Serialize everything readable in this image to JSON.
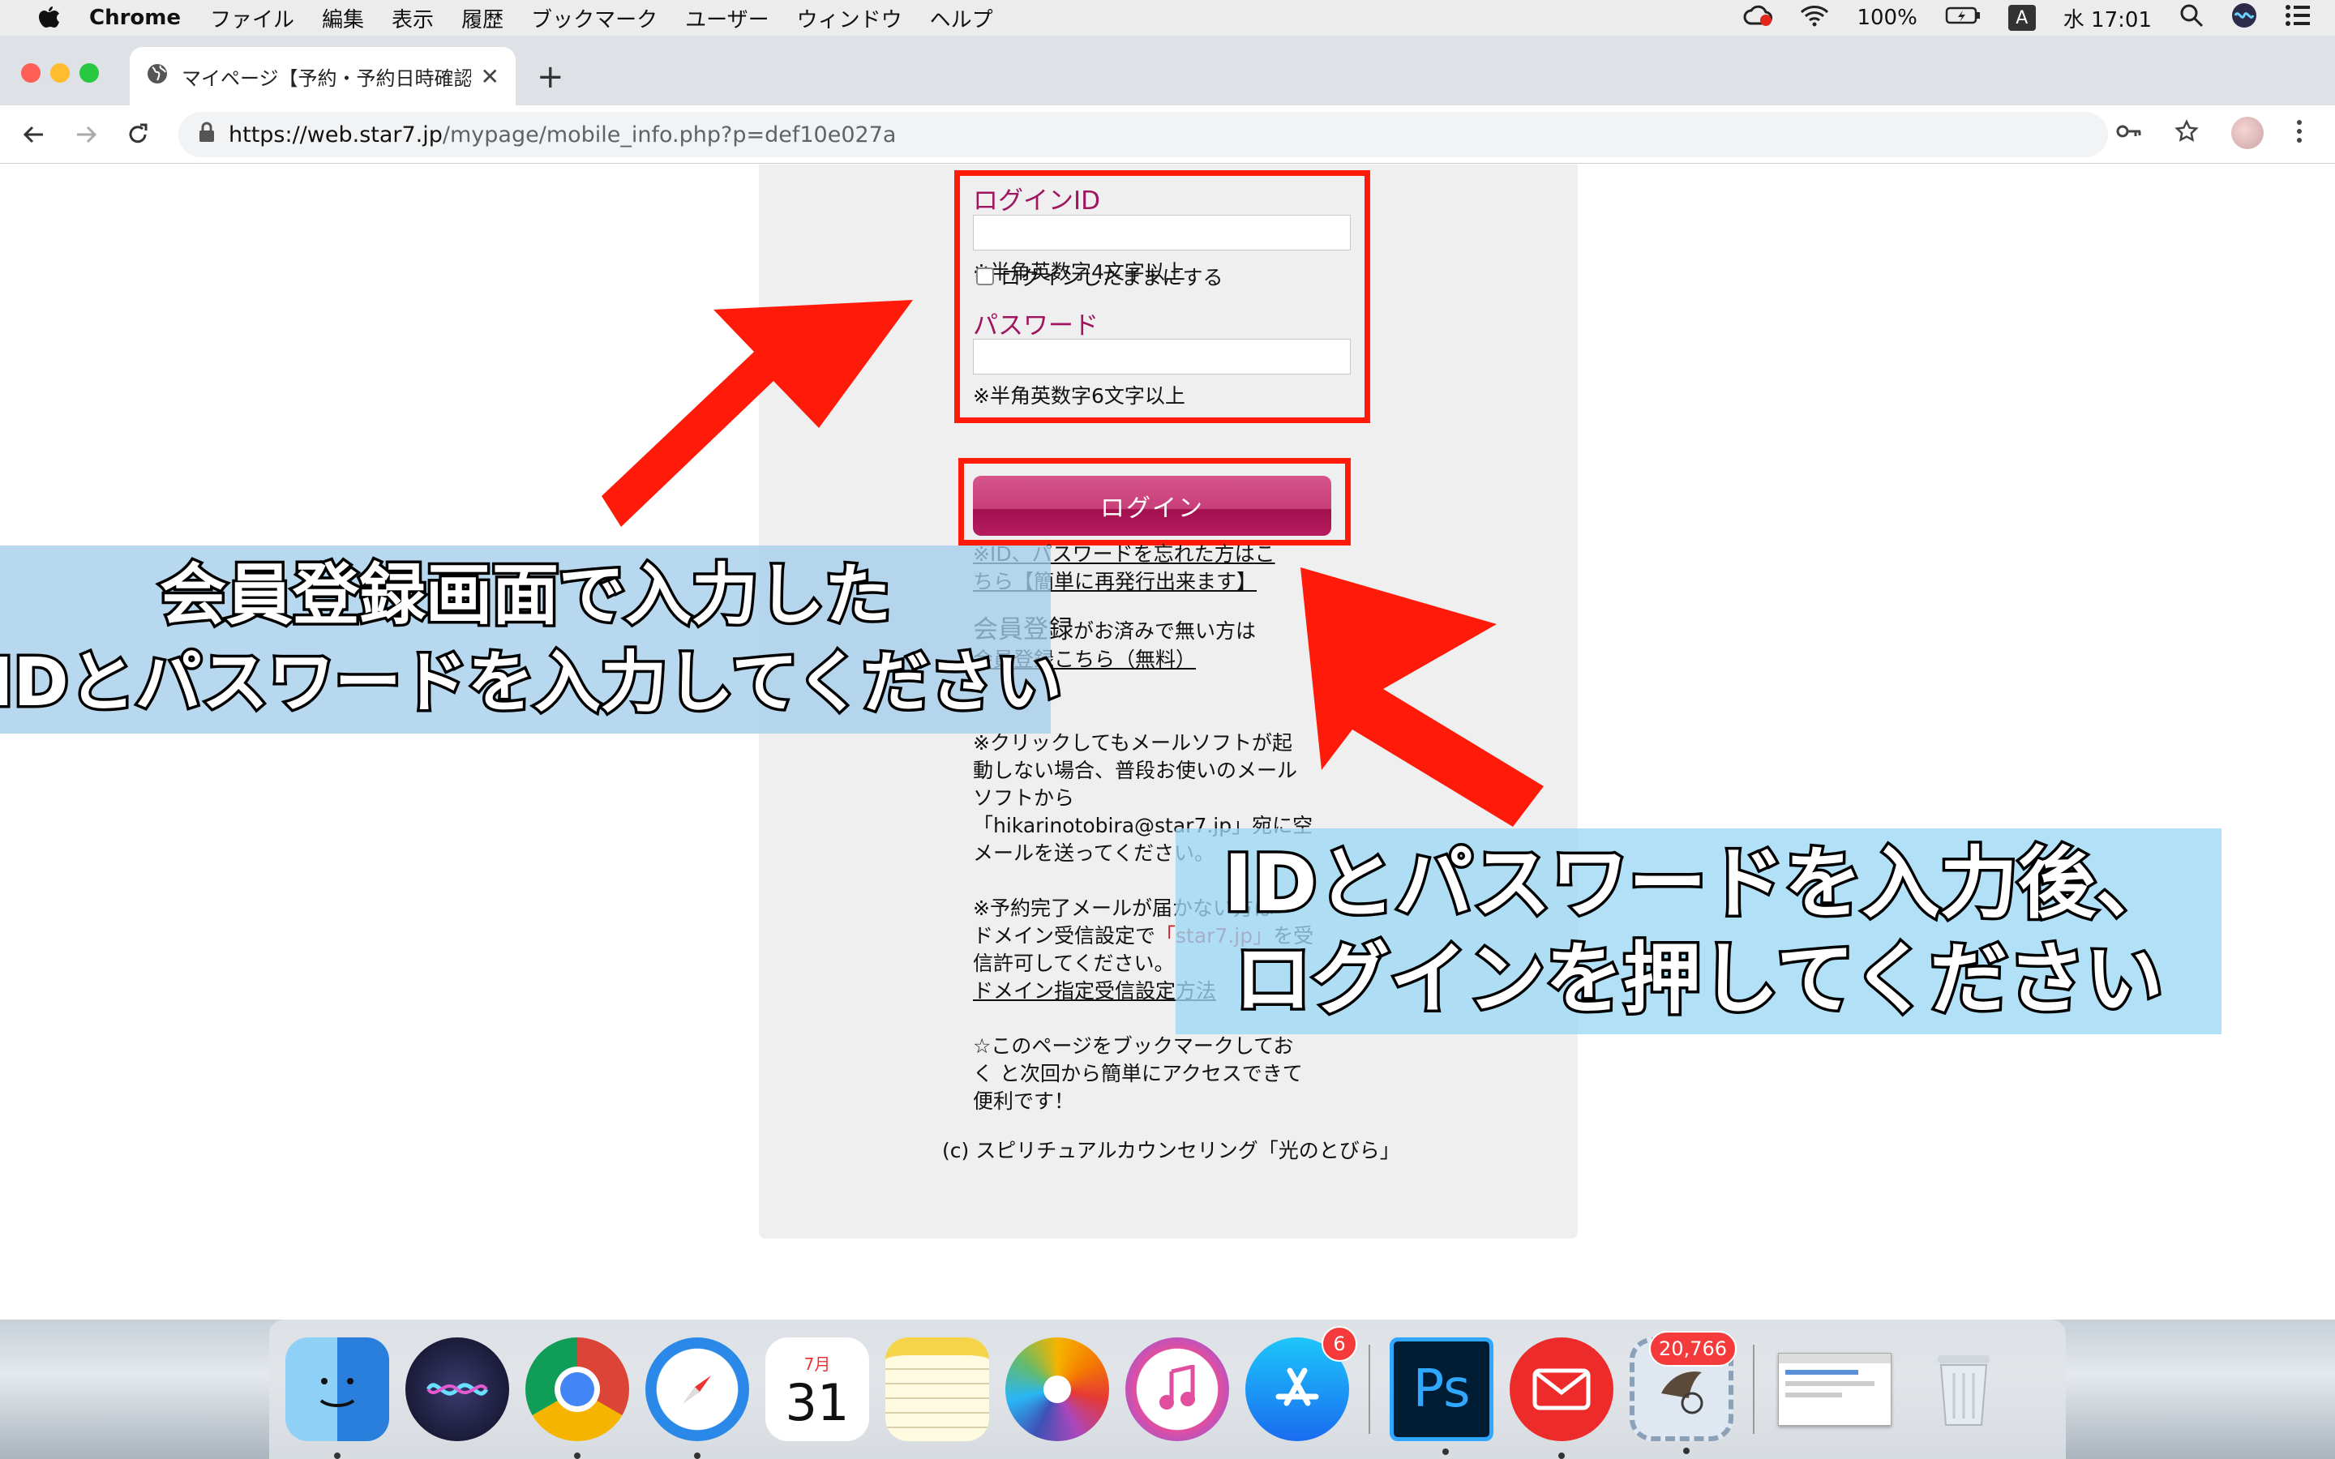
{
  "menubar": {
    "app_name": "Chrome",
    "items": [
      "ファイル",
      "編集",
      "表示",
      "履歴",
      "ブックマーク",
      "ユーザー",
      "ウィンドウ",
      "ヘルプ"
    ],
    "battery": "100%",
    "input_mode": "A",
    "clock": "水 17:01"
  },
  "browser": {
    "tab_title": "マイページ【予約・予約日時確認・",
    "url_host": "https://web.star7.jp",
    "url_path": "/mypage/mobile_info.php?p=def10e027a"
  },
  "form": {
    "login_id_label": "ログインID",
    "login_id_hint": "※半角英数字4文字以上",
    "password_label": "パスワード",
    "password_hint": "※半角英数字6文字以上",
    "remember_label": "ログインしたままにする",
    "login_button": "ログイン",
    "forgot_link_line1": "※ID、パスワードを忘れた方はこ",
    "forgot_link_line2": "ちら【簡単に再発行出来ます】",
    "register_prefix": "会員登録",
    "register_suffix": "がお済みで無い方は",
    "register_link": "会員登録こちら（無料）"
  },
  "notes": {
    "mail_note": [
      "※クリックしてもメールソフトが起",
      "動しない場合、普段お使いのメール",
      "ソフトから",
      "「hikarinotobira@star7.jp」宛に空",
      "メールを送ってください。"
    ],
    "domain_note_line1": "※予約完了メールが届かない方は",
    "domain_note_line2_prefix": "ドメイン受信設定で",
    "domain_note_domain": "「star7.jp」",
    "domain_note_line2_suffix": "を受",
    "domain_note_line3": "信許可してください。",
    "domain_link": "ドメイン指定受信設定方法",
    "bookmark_note": [
      "☆このページをブックマークしてお",
      "く と次回から簡単にアクセスできて",
      "便利です！"
    ]
  },
  "footer": {
    "copyright": "(c) スピリチュアルカウンセリング「光のとびら」"
  },
  "callouts": {
    "left": [
      "会員登録画面で入力した",
      "IDとパスワードを入力してください"
    ],
    "right": [
      "IDとパスワードを入力後、",
      "ログインを押してください"
    ]
  },
  "dock": {
    "calendar_month": "7月",
    "calendar_day": "31",
    "appstore_badge": "6",
    "mail_badge": "20,766",
    "photoshop_label": "Ps"
  },
  "colors": {
    "annotation_red": "#ff1a0a",
    "label_magenta": "#a0155f",
    "button_pink": "#c93f79"
  }
}
